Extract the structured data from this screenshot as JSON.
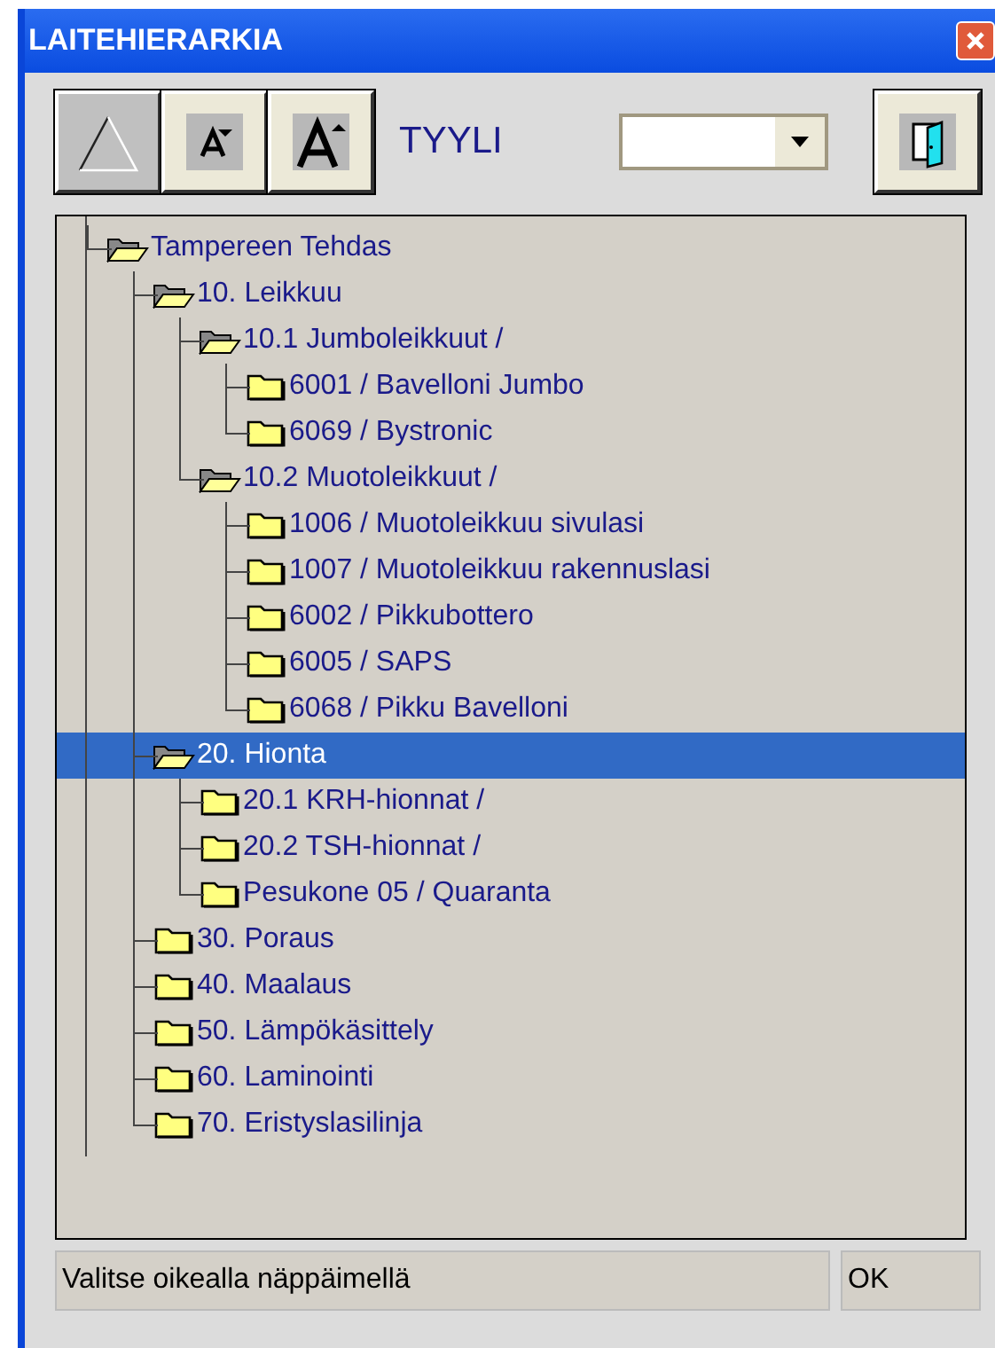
{
  "window": {
    "title": "LAITEHIERARKIA"
  },
  "toolbar": {
    "style_label": "TYYLI"
  },
  "tree": [
    {
      "label": "Tampereen Tehdas",
      "expanded": true,
      "selected": false,
      "children": [
        {
          "label": "10. Leikkuu",
          "expanded": true,
          "selected": false,
          "children": [
            {
              "label": "10.1 Jumboleikkuut /",
              "expanded": true,
              "selected": false,
              "children": [
                {
                  "label": "6001 / Bavelloni Jumbo",
                  "expanded": false,
                  "selected": false
                },
                {
                  "label": "6069 / Bystronic",
                  "expanded": false,
                  "selected": false
                }
              ]
            },
            {
              "label": "10.2 Muotoleikkuut /",
              "expanded": true,
              "selected": false,
              "children": [
                {
                  "label": "1006 / Muotoleikkuu sivulasi",
                  "expanded": false,
                  "selected": false
                },
                {
                  "label": "1007 / Muotoleikkuu rakennuslasi",
                  "expanded": false,
                  "selected": false
                },
                {
                  "label": "6002 / Pikkubottero",
                  "expanded": false,
                  "selected": false
                },
                {
                  "label": "6005 / SAPS",
                  "expanded": false,
                  "selected": false
                },
                {
                  "label": "6068 / Pikku Bavelloni",
                  "expanded": false,
                  "selected": false
                }
              ]
            }
          ]
        },
        {
          "label": "20. Hionta",
          "expanded": true,
          "selected": true,
          "children": [
            {
              "label": "20.1 KRH-hionnat /",
              "expanded": false,
              "selected": false
            },
            {
              "label": "20.2 TSH-hionnat /",
              "expanded": false,
              "selected": false
            },
            {
              "label": "Pesukone 05 / Quaranta",
              "expanded": false,
              "selected": false
            }
          ]
        },
        {
          "label": "30. Poraus",
          "expanded": false,
          "selected": false
        },
        {
          "label": "40. Maalaus",
          "expanded": false,
          "selected": false
        },
        {
          "label": "50. Lämpökäsittely",
          "expanded": false,
          "selected": false
        },
        {
          "label": "60. Laminointi",
          "expanded": false,
          "selected": false
        },
        {
          "label": "70. Eristyslasilinja",
          "expanded": false,
          "selected": false
        }
      ]
    }
  ],
  "status_bar": {
    "message": "Valitse oikealla näppäimellä",
    "state": "OK"
  }
}
